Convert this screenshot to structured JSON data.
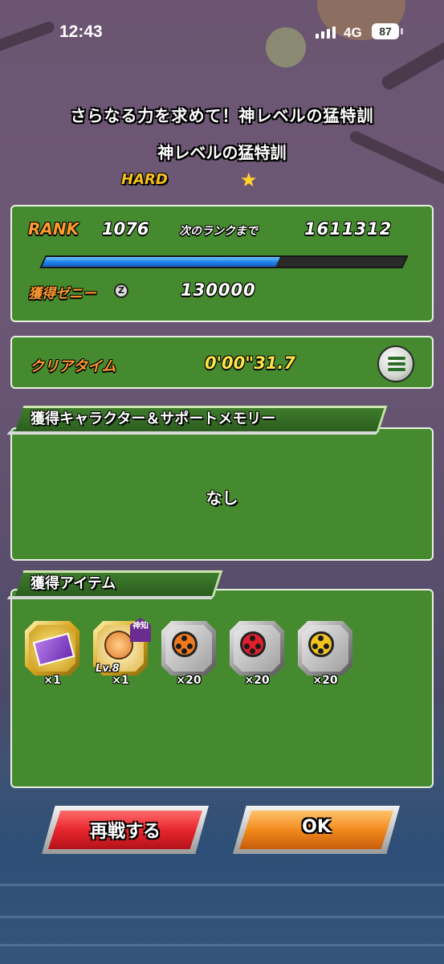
{
  "status_bar": {
    "time": "12:43",
    "network": "4G",
    "battery": "87"
  },
  "stage": {
    "title": "さらなる力を求めて！神レベルの猛特訓",
    "subtitle": "神レベルの猛特訓",
    "difficulty": "HARD"
  },
  "rank_panel": {
    "rank_label": "RANK",
    "rank_value": "1076",
    "next_label": "次のランクまで",
    "next_value": "1611312",
    "exp_progress_percent": 65,
    "zeni_label": "獲得ゼニー",
    "zeni_icon": "Z",
    "zeni_value": "130000"
  },
  "clear_panel": {
    "label": "クリアタイム",
    "value": "0'00\"31.7"
  },
  "characters_section": {
    "header": "獲得キャラクター＆サポートメモリー",
    "empty_text": "なし"
  },
  "items_section": {
    "header": "獲得アイテム",
    "items": [
      {
        "name": "ticket-item",
        "quantity": "×1"
      },
      {
        "name": "training-item",
        "level": "Lv.8",
        "tag": "神知",
        "quantity": "×1"
      },
      {
        "name": "orange-reel-item",
        "quantity": "×20"
      },
      {
        "name": "red-reel-item",
        "quantity": "×20"
      },
      {
        "name": "gold-reel-item",
        "quantity": "×20"
      }
    ]
  },
  "buttons": {
    "retry": "再戦する",
    "ok": "OK"
  },
  "colors": {
    "panel_green": "#468a2f",
    "label_orange": "#ff9a2e",
    "progress_blue": "#1d7fe8",
    "retry_red": "#e8262e",
    "ok_orange": "#f28a1e"
  }
}
